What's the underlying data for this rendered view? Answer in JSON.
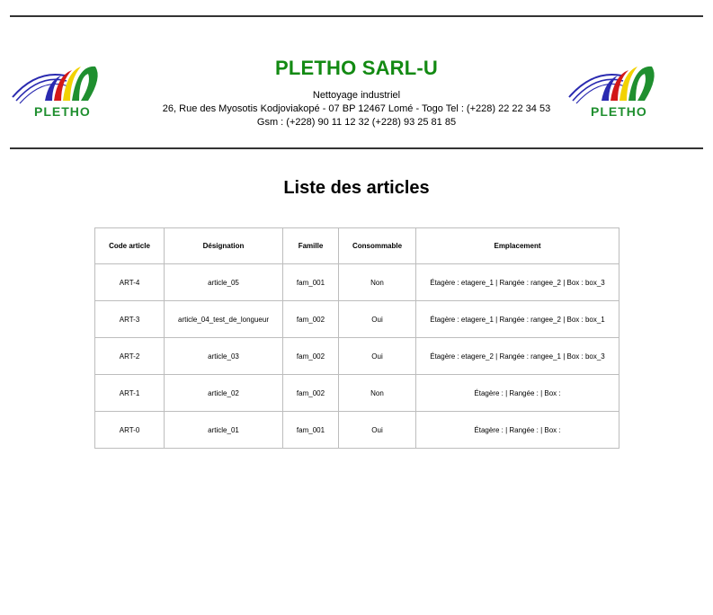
{
  "header": {
    "company_name": "PLETHO SARL-U",
    "activity": "Nettoyage industriel",
    "address_line": "26, Rue des Myosotis Kodjoviakopé - 07 BP 12467 Lomé - Togo Tel : (+228) 22 22 34 53",
    "gsm_line": "Gsm : (+228) 90 11 12 32 (+228) 93 25 81 85",
    "logo_text": "PLETHO",
    "colors": {
      "company_name": "#138a13",
      "logo_blue": "#2a2ab0",
      "logo_red": "#d21818",
      "logo_yellow": "#f2d200",
      "logo_green": "#1f8f2f"
    }
  },
  "page_title": "Liste des articles",
  "table": {
    "headers": [
      "Code article",
      "Désignation",
      "Famille",
      "Consommable",
      "Emplacement"
    ],
    "rows": [
      [
        "ART-4",
        "article_05",
        "fam_001",
        "Non",
        "Étagère : etagere_1 | Rangée : rangee_2 | Box : box_3"
      ],
      [
        "ART-3",
        "article_04_test_de_longueur",
        "fam_002",
        "Oui",
        "Étagère : etagere_1 | Rangée : rangee_2 | Box : box_1"
      ],
      [
        "ART-2",
        "article_03",
        "fam_002",
        "Oui",
        "Étagère : etagere_2 | Rangée : rangee_1 | Box : box_3"
      ],
      [
        "ART-1",
        "article_02",
        "fam_002",
        "Non",
        "Étagère : | Rangée : | Box :"
      ],
      [
        "ART-0",
        "article_01",
        "fam_001",
        "Oui",
        "Étagère : | Rangée : | Box :"
      ]
    ]
  }
}
